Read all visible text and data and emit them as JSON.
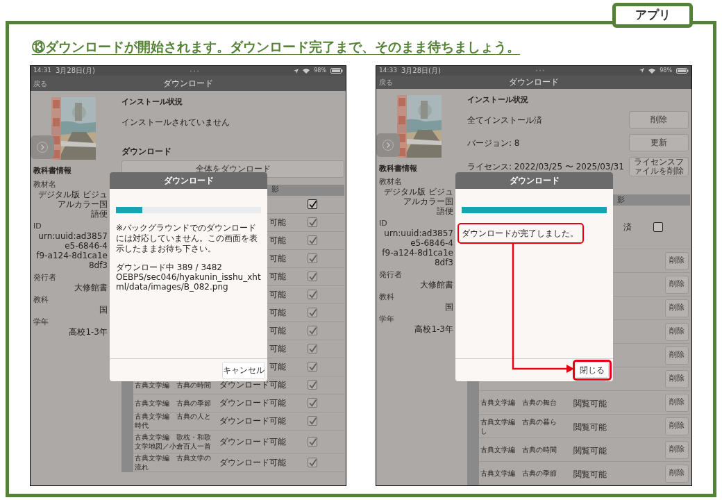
{
  "banner": {
    "tab": "アプリ",
    "heading": "⑬ダウンロードが開始されます。ダウンロード完了まで、そのまま待ちましょう。"
  },
  "screens": [
    {
      "status": {
        "time": "14:31",
        "date": "3月28日(月)",
        "battery": "98%"
      },
      "nav": {
        "back": "戻る",
        "title": "ダウンロード"
      },
      "info": {
        "title": "教科書情報",
        "fields": [
          {
            "label": "教材名",
            "lines": [
              "デジタル版 ビジュアルカラー国",
              "語便"
            ]
          },
          {
            "label": "ID",
            "lines": [
              "urn:uuid:ad3857e5-6846-4",
              "f9-a124-8d1ca1e8df3"
            ]
          },
          {
            "label": "発行者",
            "lines": [
              "大修館書"
            ]
          },
          {
            "label": "教科",
            "lines": [
              "国"
            ]
          },
          {
            "label": "学年",
            "lines": [
              "高校1-3年"
            ]
          }
        ]
      },
      "install": {
        "title": "インストール状況",
        "items": [
          {
            "text": "インストールされていません"
          }
        ]
      },
      "download": {
        "title": "ダウンロード",
        "button": "全体をダウンロード"
      },
      "table": {
        "header": "影",
        "rows": [
          {
            "kind": "checkbox",
            "checked": true,
            "disabled": false
          },
          {
            "kind": "checkbox",
            "status": "可能",
            "checked": true,
            "disabled": true
          },
          {
            "kind": "checkbox",
            "status": "可能",
            "checked": true,
            "disabled": true
          },
          {
            "kind": "checkbox",
            "status": "可能",
            "checked": true,
            "disabled": true
          },
          {
            "kind": "checkbox",
            "status": "可能",
            "checked": true,
            "disabled": true
          },
          {
            "kind": "checkbox",
            "status": "可能",
            "checked": true,
            "disabled": true
          },
          {
            "kind": "checkbox",
            "status": "可能",
            "checked": true,
            "disabled": true
          },
          {
            "kind": "checkbox",
            "status": "可能",
            "checked": true,
            "disabled": true
          },
          {
            "kind": "checkbox",
            "status": "可能",
            "checked": true,
            "disabled": true
          },
          {
            "kind": "checkbox",
            "status": "可能",
            "checked": true,
            "disabled": true
          },
          {
            "kind": "checkbox",
            "title": "古典文学編　古典の時間",
            "status": "ダウンロード可能",
            "checked": true,
            "disabled": true
          },
          {
            "kind": "checkbox",
            "title": "古典文学編　古典の季節",
            "status": "ダウンロード可能",
            "checked": true,
            "disabled": true
          },
          {
            "kind": "checkbox",
            "title": "古典文学編　古典の人と時代",
            "status": "ダウンロード可能",
            "checked": true,
            "disabled": true
          },
          {
            "kind": "checkbox",
            "title": "古典文学編　歌枕・和歌文学地図／小倉百人一首",
            "status": "ダウンロード可能",
            "checked": true,
            "disabled": true
          },
          {
            "kind": "checkbox",
            "title": "古典文学編　古典文学の流れ",
            "status": "ダウンロード可能",
            "checked": true,
            "disabled": true
          }
        ]
      },
      "dialog": {
        "title": "ダウンロード",
        "level": 0.18,
        "callout": false,
        "messages": [
          "※バックグラウンドでのダウンロードには対応していません。この画面を表示したままお待ち下さい。",
          "ダウンロード中 389 / 3482",
          "OEBPS/sec046/hyakunin_isshu_xhtml/data/images/B_082.png"
        ],
        "button": "キャンセル"
      }
    },
    {
      "status": {
        "time": "14:33",
        "date": "3月28日(月)",
        "battery": "98%"
      },
      "nav": {
        "back": "戻る",
        "title": "ダウンロード"
      },
      "info": {
        "title": "教科書情報",
        "fields": [
          {
            "label": "教材名",
            "lines": [
              "デジタル版 ビジュアルカラー国",
              "語便"
            ]
          },
          {
            "label": "ID",
            "lines": [
              "urn:uuid:ad3857e5-6846-4",
              "f9-a124-8d1ca1e8df3"
            ]
          },
          {
            "label": "発行者",
            "lines": [
              "大修館書"
            ]
          },
          {
            "label": "教科",
            "lines": [
              "国"
            ]
          },
          {
            "label": "学年",
            "lines": [
              "高校1-3年"
            ]
          }
        ]
      },
      "install": {
        "title": "インストール状況",
        "items": [
          {
            "text": "全てインストール済",
            "button": "削除"
          },
          {
            "text": "バージョン: 8",
            "button": "更新"
          },
          {
            "text": "ライセンス: 2022/03/25 〜 2025/03/31",
            "button": "ライセンスファイルを削除"
          }
        ]
      },
      "table": {
        "header": "影",
        "rows": [
          {
            "kind": "checkbox",
            "status": "済",
            "checked": false,
            "disabled": false
          },
          {
            "kind": "delete",
            "button": "削除"
          },
          {
            "kind": "delete",
            "button": "削除"
          },
          {
            "kind": "delete",
            "button": "削除"
          },
          {
            "kind": "delete",
            "button": "削除"
          },
          {
            "kind": "delete",
            "button": "削除"
          },
          {
            "kind": "delete",
            "button": "削除"
          },
          {
            "kind": "delete",
            "title": "古典文学編　古典の舞台",
            "status": "閲覧可能",
            "button": "削除"
          },
          {
            "kind": "delete",
            "title": "古典文学編　古典の暮らし",
            "status": "閲覧可能",
            "button": "削除"
          },
          {
            "kind": "delete",
            "title": "古典文学編　古典の時間",
            "status": "閲覧可能",
            "button": "削除"
          },
          {
            "kind": "delete",
            "title": "古典文学編　古典の季節",
            "status": "閲覧可能",
            "button": "削除"
          }
        ]
      },
      "dialog": {
        "title": "ダウンロード",
        "level": 1,
        "callout": true,
        "messages": [
          "ダウンロードが完了しました。"
        ],
        "button": "閉じる"
      }
    }
  ]
}
